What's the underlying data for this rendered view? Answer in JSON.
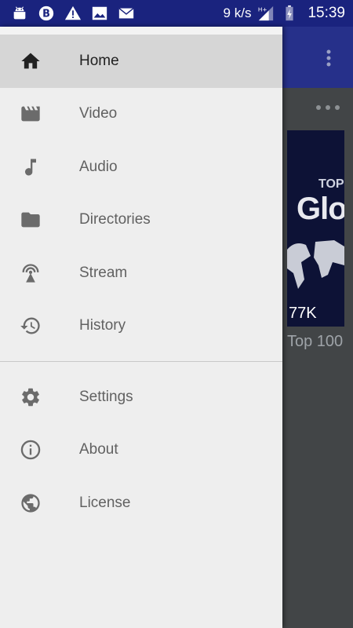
{
  "status_bar": {
    "speed": "9 k/s",
    "network": "H+",
    "time": "15:39",
    "icons": [
      "android-icon",
      "b-badge-icon",
      "warning-icon",
      "image-icon",
      "mail-icon"
    ]
  },
  "background": {
    "thumbnail_text_top": "TOP",
    "thumbnail_text_main": "Glo",
    "thumbnail_count": "77K",
    "caption": "Top 100"
  },
  "drawer": {
    "primary": [
      {
        "label": "Home",
        "icon": "home-icon",
        "active": true
      },
      {
        "label": "Video",
        "icon": "movie-icon",
        "active": false
      },
      {
        "label": "Audio",
        "icon": "music-note-icon",
        "active": false
      },
      {
        "label": "Directories",
        "icon": "folder-icon",
        "active": false
      },
      {
        "label": "Stream",
        "icon": "antenna-icon",
        "active": false
      },
      {
        "label": "History",
        "icon": "history-icon",
        "active": false
      }
    ],
    "secondary": [
      {
        "label": "Settings",
        "icon": "gear-icon"
      },
      {
        "label": "About",
        "icon": "info-icon"
      },
      {
        "label": "License",
        "icon": "globe-icon"
      }
    ]
  },
  "colors": {
    "status_bar": "#1a237e",
    "drawer_bg": "#eeeeee",
    "active_bg": "#d6d6d6",
    "label": "#616161"
  }
}
